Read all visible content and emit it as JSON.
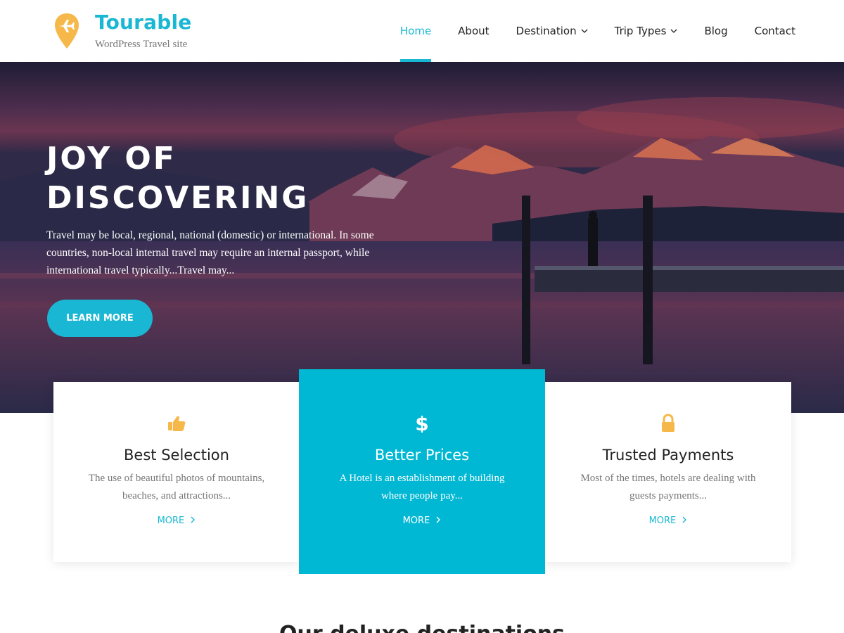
{
  "site": {
    "title": "Tourable",
    "tagline": "WordPress Travel site",
    "accent_color": "#1ab7d4",
    "logo_icon": "airplane-pin-icon",
    "logo_color": "#f6b84a"
  },
  "nav": {
    "items": [
      {
        "label": "Home",
        "active": true
      },
      {
        "label": "About"
      },
      {
        "label": "Destination",
        "dropdown": true
      },
      {
        "label": "Trip Types",
        "dropdown": true
      },
      {
        "label": "Blog"
      },
      {
        "label": "Contact"
      }
    ]
  },
  "hero": {
    "title_line1": "JOY OF",
    "title_line2": "DISCOVERING",
    "text": "Travel may be local, regional, national (domestic) or international. In some countries, non-local internal travel may require an internal passport, while international travel typically...Travel may...",
    "button_label": "LEARN MORE"
  },
  "features": [
    {
      "icon": "thumbs-up-icon",
      "title": "Best Selection",
      "text": "The use of beautiful photos of mountains, beaches, and attractions...",
      "more": "MORE"
    },
    {
      "icon": "dollar-icon",
      "title": "Better Prices",
      "text": "A Hotel is an establishment of building where people pay...",
      "more": "MORE",
      "highlight_color": "#00b8d4"
    },
    {
      "icon": "lock-icon",
      "title": "Trusted Payments",
      "text": "Most of the times, hotels are dealing with guests payments...",
      "more": "MORE"
    }
  ],
  "next_section": {
    "heading": "Our deluxe destinations"
  }
}
